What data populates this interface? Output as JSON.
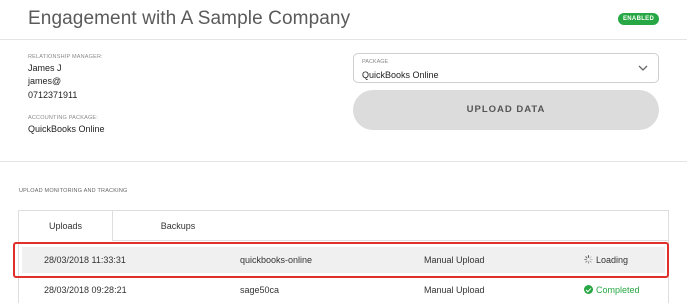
{
  "header": {
    "title": "Engagement with A Sample Company",
    "status_badge": "ENABLED",
    "status_color": "#27a844"
  },
  "details": {
    "relationship_manager_label": "RELATIONSHIP MANAGER:",
    "manager_name": "James J",
    "manager_email": "james@",
    "manager_phone": "0712371911",
    "accounting_package_label": "ACCOUNTING PACKAGE:",
    "accounting_package": "QuickBooks Online"
  },
  "package_select": {
    "label": "PACKAGE",
    "value": "QuickBooks Online",
    "icon": "chevron-down-icon"
  },
  "upload_button": {
    "label": "UPLOAD DATA"
  },
  "monitoring": {
    "section_title": "UPLOAD MONITORING AND TRACKING",
    "tabs": [
      {
        "label": "Uploads",
        "active": true
      },
      {
        "label": "Backups",
        "active": false
      }
    ],
    "rows": [
      {
        "datetime": "28/03/2018 11:33:31",
        "source": "quickbooks-online",
        "type": "Manual Upload",
        "status": "Loading",
        "status_icon": "spinner-icon",
        "highlighted": true
      },
      {
        "datetime": "28/03/2018 09:28:21",
        "source": "sage50ca",
        "type": "Manual Upload",
        "status": "Completed",
        "status_icon": "check-circle-icon",
        "status_color": "#27a844"
      }
    ]
  },
  "colors": {
    "highlight_border": "#e0302a",
    "accent_green": "#27a844"
  }
}
